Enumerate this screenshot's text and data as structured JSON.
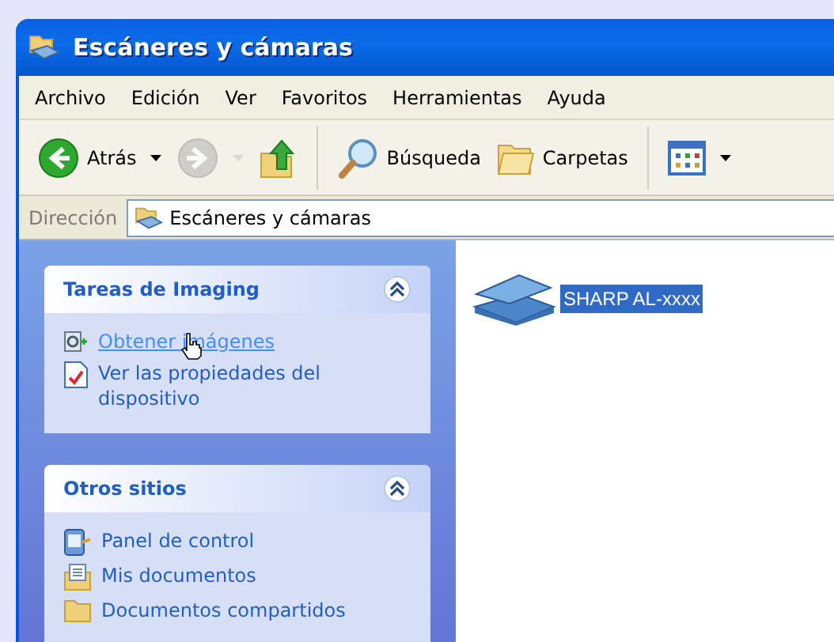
{
  "window": {
    "title": "Escáneres y cámaras"
  },
  "menu": [
    "Archivo",
    "Edición",
    "Ver",
    "Favoritos",
    "Herramientas",
    "Ayuda"
  ],
  "toolbar": [
    {
      "kind": "back",
      "label": "Atrás",
      "disabled": false
    },
    {
      "kind": "forward",
      "disabled": true
    },
    {
      "kind": "up",
      "disabled": false
    },
    {
      "kind": "search",
      "label": "Búsqueda",
      "disabled": false
    },
    {
      "kind": "folders",
      "label": "Carpetas",
      "disabled": false
    },
    {
      "kind": "views",
      "disabled": false
    }
  ],
  "address": {
    "label": "Dirección",
    "value": "Escáneres y cámaras"
  },
  "task_panels": [
    {
      "title": "Tareas de Imaging",
      "expanded": true,
      "items": [
        {
          "kind": "camera",
          "label": "Obtener imágenes",
          "hovered": true
        },
        {
          "kind": "properties",
          "label": "Ver las propiedades del dispositivo",
          "hovered": false
        }
      ]
    },
    {
      "title": "Otros sitios",
      "expanded": true,
      "items": [
        {
          "kind": "control-panel",
          "label": "Panel de control",
          "hovered": false
        },
        {
          "kind": "documents",
          "label": "Mis documentos",
          "hovered": false
        },
        {
          "kind": "folder",
          "label": "Documentos compartidos",
          "hovered": false
        }
      ]
    }
  ],
  "devices": [
    {
      "name": "SHARP AL-xxxx",
      "selected": true
    }
  ]
}
